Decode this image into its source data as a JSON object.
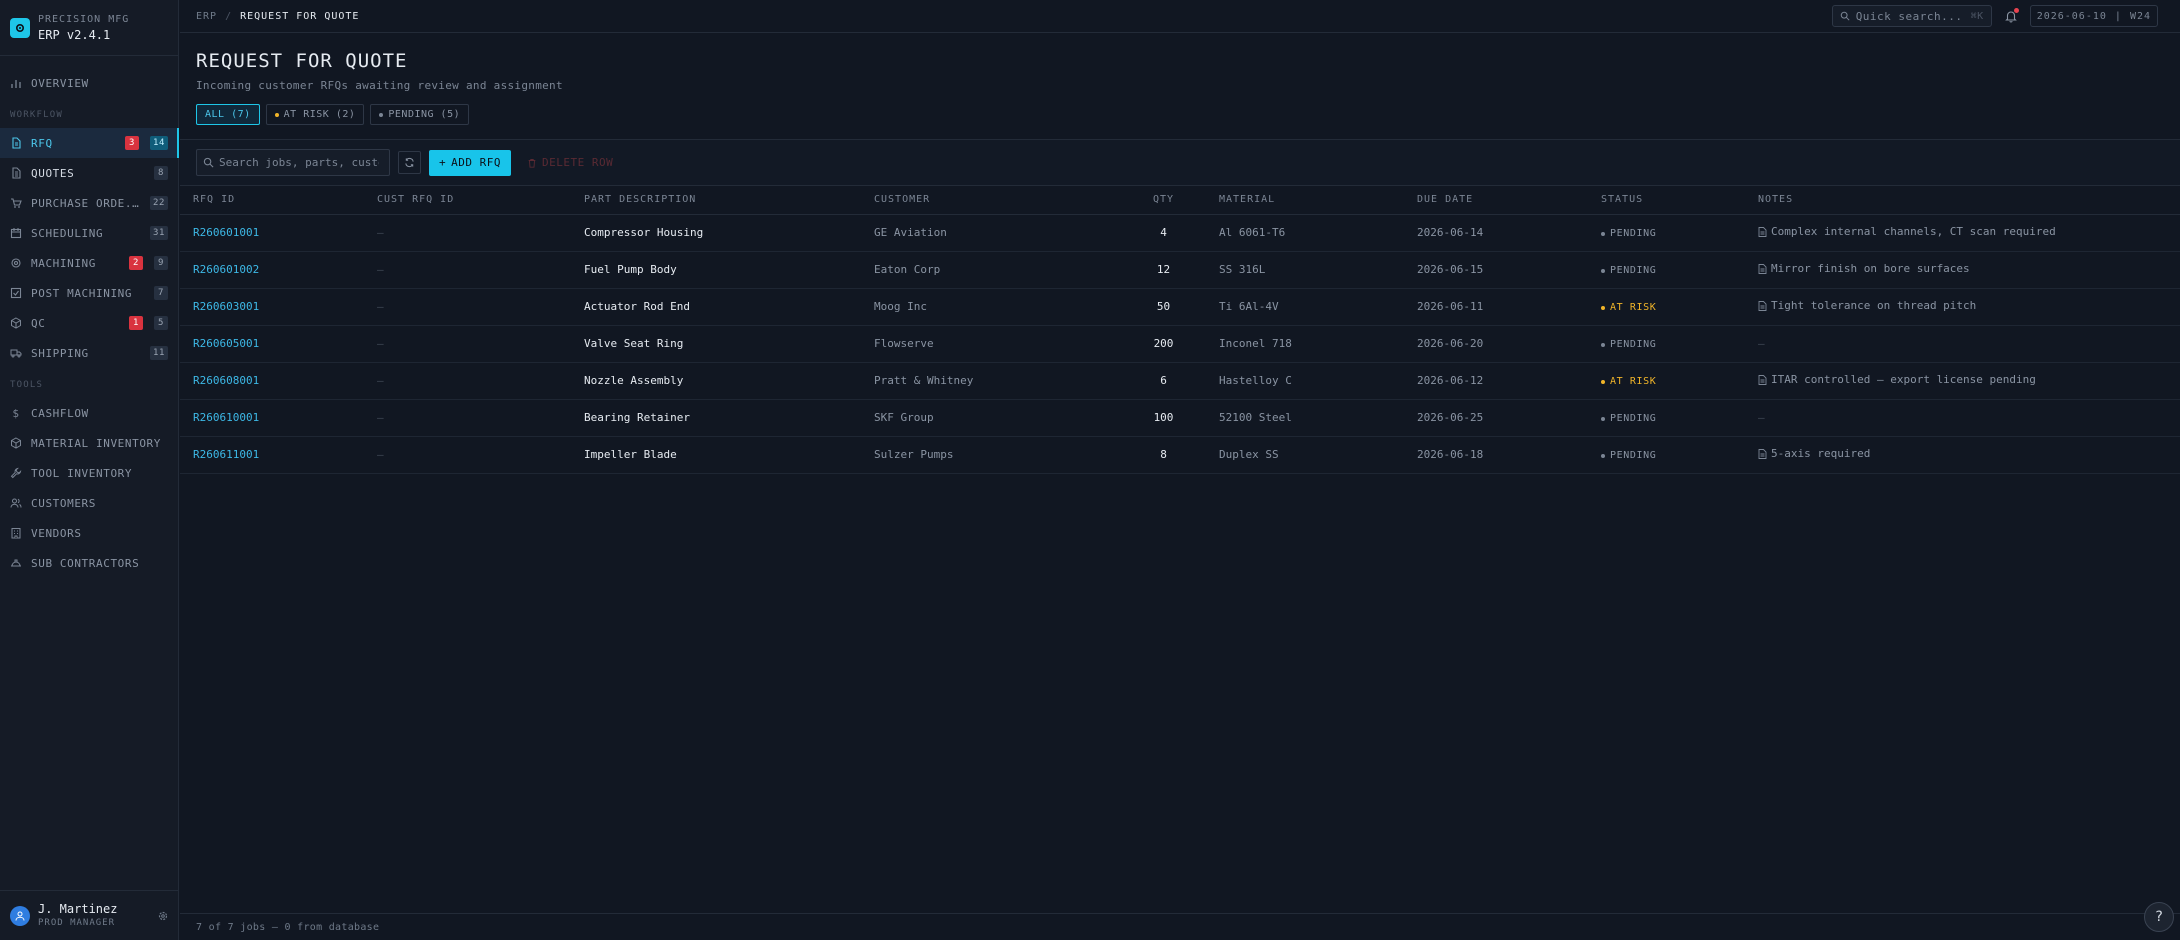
{
  "brand": {
    "company": "PRECISION MFG",
    "version": "ERP v2.4.1"
  },
  "sidebar": {
    "overview": "OVERVIEW",
    "workflow_title": "WORKFLOW",
    "workflow": [
      {
        "label": "RFQ",
        "alert": "3",
        "count": "14"
      },
      {
        "label": "QUOTES",
        "count": "8"
      },
      {
        "label": "PURCHASE ORDE...",
        "count": "22"
      },
      {
        "label": "SCHEDULING",
        "count": "31"
      },
      {
        "label": "MACHINING",
        "alert": "2",
        "count": "9"
      },
      {
        "label": "POST MACHINING",
        "count": "7"
      },
      {
        "label": "QC",
        "alert": "1",
        "count": "5"
      },
      {
        "label": "SHIPPING",
        "count": "11"
      }
    ],
    "tools_title": "TOOLS",
    "tools": [
      {
        "label": "CASHFLOW"
      },
      {
        "label": "MATERIAL INVENTORY"
      },
      {
        "label": "TOOL INVENTORY"
      },
      {
        "label": "CUSTOMERS"
      },
      {
        "label": "VENDORS"
      },
      {
        "label": "SUB CONTRACTORS"
      }
    ]
  },
  "user": {
    "name": "J. Martinez",
    "role": "PROD MANAGER"
  },
  "topbar": {
    "crumb_root": "ERP",
    "crumb_sep": "/",
    "crumb_current": "REQUEST FOR QUOTE",
    "quick_search": "Quick search...",
    "quick_search_kbd": "⌘K",
    "date": "2026-06-10",
    "date_sep": "|",
    "week": "W24"
  },
  "header": {
    "title": "REQUEST FOR QUOTE",
    "subtitle": "Incoming customer RFQs awaiting review and assignment",
    "filters": [
      {
        "label": "ALL (7)"
      },
      {
        "label": "AT RISK (2)"
      },
      {
        "label": "PENDING (5)"
      }
    ]
  },
  "toolbar": {
    "search_placeholder": "Search jobs, parts, customers...",
    "add_label": "ADD RFQ",
    "delete_label": "DELETE ROW"
  },
  "colors": {
    "accent": "#18c4ea",
    "pending": "#7b8594",
    "at_risk": "#f0b429",
    "alert": "#d9333f"
  },
  "table": {
    "columns": [
      "RFQ ID",
      "CUST RFQ ID",
      "PART DESCRIPTION",
      "CUSTOMER",
      "QTY",
      "MATERIAL",
      "DUE DATE",
      "STATUS",
      "NOTES"
    ],
    "rows": [
      {
        "rfq": "R260601001",
        "cust": "—",
        "part": "Compressor Housing",
        "customer": "GE Aviation",
        "qty": "4",
        "material": "Al 6061-T6",
        "due": "2026-06-14",
        "status": "PENDING",
        "notes": "Complex internal channels, CT scan required"
      },
      {
        "rfq": "R260601002",
        "cust": "—",
        "part": "Fuel Pump Body",
        "customer": "Eaton Corp",
        "qty": "12",
        "material": "SS 316L",
        "due": "2026-06-15",
        "status": "PENDING",
        "notes": "Mirror finish on bore surfaces"
      },
      {
        "rfq": "R260603001",
        "cust": "—",
        "part": "Actuator Rod End",
        "customer": "Moog Inc",
        "qty": "50",
        "material": "Ti 6Al-4V",
        "due": "2026-06-11",
        "status": "AT RISK",
        "notes": "Tight tolerance on thread pitch"
      },
      {
        "rfq": "R260605001",
        "cust": "—",
        "part": "Valve Seat Ring",
        "customer": "Flowserve",
        "qty": "200",
        "material": "Inconel 718",
        "due": "2026-06-20",
        "status": "PENDING",
        "notes": ""
      },
      {
        "rfq": "R260608001",
        "cust": "—",
        "part": "Nozzle Assembly",
        "customer": "Pratt & Whitney",
        "qty": "6",
        "material": "Hastelloy C",
        "due": "2026-06-12",
        "status": "AT RISK",
        "notes": "ITAR controlled — export license pending"
      },
      {
        "rfq": "R260610001",
        "cust": "—",
        "part": "Bearing Retainer",
        "customer": "SKF Group",
        "qty": "100",
        "material": "52100 Steel",
        "due": "2026-06-25",
        "status": "PENDING",
        "notes": ""
      },
      {
        "rfq": "R260611001",
        "cust": "—",
        "part": "Impeller Blade",
        "customer": "Sulzer Pumps",
        "qty": "8",
        "material": "Duplex SS",
        "due": "2026-06-18",
        "status": "PENDING",
        "notes": "5-axis required"
      }
    ],
    "empty_note": "—"
  },
  "footer": {
    "summary": "7 of 7 jobs — 0 from database"
  },
  "help_label": "?"
}
